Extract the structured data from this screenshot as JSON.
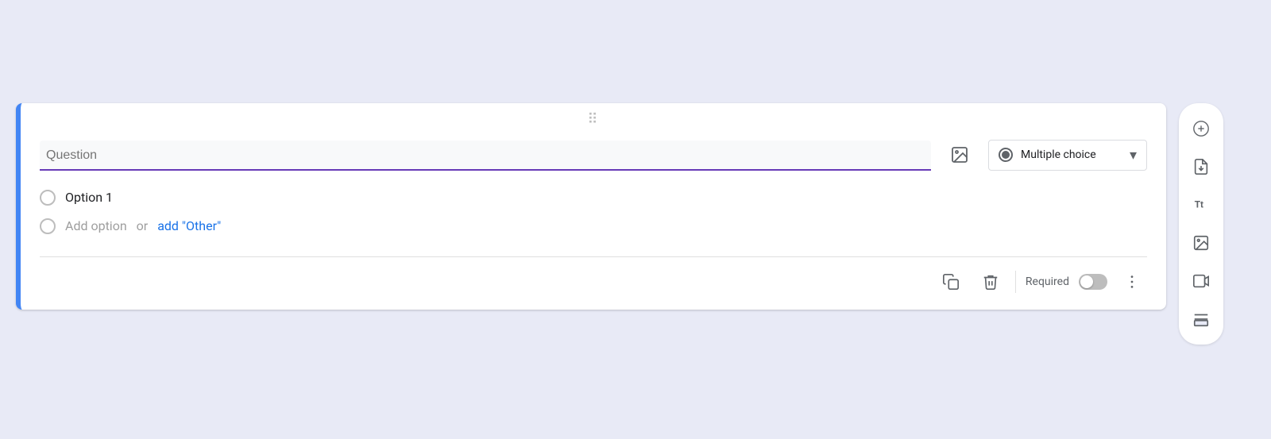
{
  "card": {
    "drag_handle": "⠿",
    "question_placeholder": "Question",
    "question_underline_color": "#673ab7",
    "type_label": "Multiple choice",
    "option1_label": "Option 1",
    "add_option_label": "Add option",
    "or_label": "or",
    "add_other_label": "add \"Other\"",
    "required_label": "Required"
  },
  "sidebar": {
    "add_icon": "add-circle-icon",
    "import_icon": "import-icon",
    "text_icon": "text-icon",
    "image_icon": "image-icon",
    "video_icon": "video-icon",
    "section_icon": "section-icon"
  },
  "footer": {
    "copy_icon": "copy-icon",
    "delete_icon": "delete-icon",
    "more_icon": "more-vert-icon"
  }
}
